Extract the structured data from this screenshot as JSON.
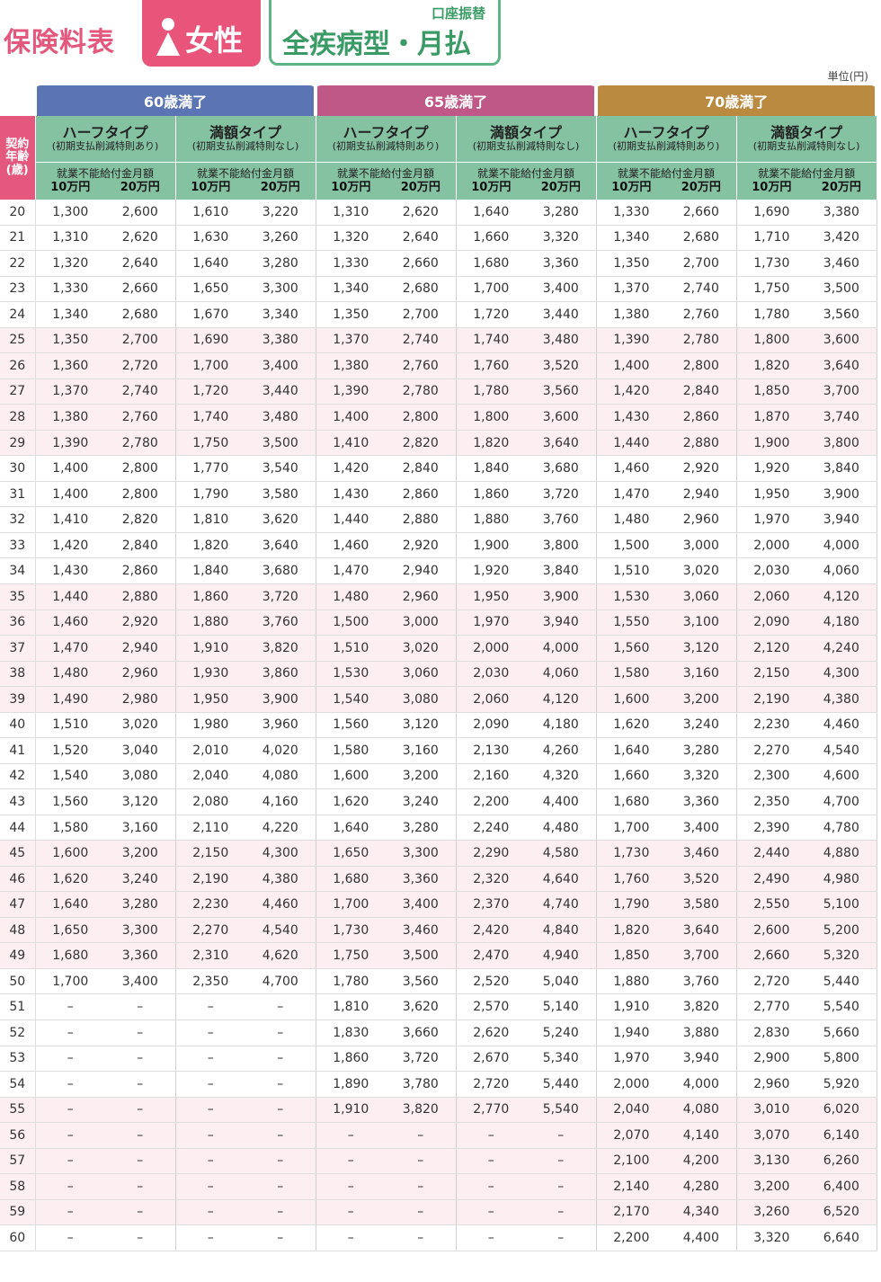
{
  "header": {
    "title": "保険料表",
    "gender_label": "女性",
    "payment_method": "口座振替",
    "plan_label": "全疾病型・月払",
    "unit": "単位(円)"
  },
  "colors": {
    "title_pink": "#e5587d",
    "term_60": "#5a74b4",
    "term_65": "#bf5787",
    "term_70": "#b98a40",
    "header_green": "#84c2a2",
    "row_pink": "#fdeef2"
  },
  "table": {
    "age_header": "契約年齢(歳)",
    "terms": [
      {
        "label": "60歳満了"
      },
      {
        "label": "65歳満了"
      },
      {
        "label": "70歳満了"
      }
    ],
    "types": [
      {
        "name": "ハーフタイプ",
        "note": "(初期支払削減特則あり)"
      },
      {
        "name": "満額タイプ",
        "note": "(初期支払削減特則なし)"
      }
    ],
    "benefit_label": "就業不能給付金月額",
    "amounts": [
      "10万円",
      "20万円"
    ],
    "rows": [
      {
        "age": "20",
        "v": [
          "1,300",
          "2,600",
          "1,610",
          "3,220",
          "1,310",
          "2,620",
          "1,640",
          "3,280",
          "1,330",
          "2,660",
          "1,690",
          "3,380"
        ]
      },
      {
        "age": "21",
        "v": [
          "1,310",
          "2,620",
          "1,630",
          "3,260",
          "1,320",
          "2,640",
          "1,660",
          "3,320",
          "1,340",
          "2,680",
          "1,710",
          "3,420"
        ]
      },
      {
        "age": "22",
        "v": [
          "1,320",
          "2,640",
          "1,640",
          "3,280",
          "1,330",
          "2,660",
          "1,680",
          "3,360",
          "1,350",
          "2,700",
          "1,730",
          "3,460"
        ]
      },
      {
        "age": "23",
        "v": [
          "1,330",
          "2,660",
          "1,650",
          "3,300",
          "1,340",
          "2,680",
          "1,700",
          "3,400",
          "1,370",
          "2,740",
          "1,750",
          "3,500"
        ]
      },
      {
        "age": "24",
        "v": [
          "1,340",
          "2,680",
          "1,670",
          "3,340",
          "1,350",
          "2,700",
          "1,720",
          "3,440",
          "1,380",
          "2,760",
          "1,780",
          "3,560"
        ]
      },
      {
        "age": "25",
        "v": [
          "1,350",
          "2,700",
          "1,690",
          "3,380",
          "1,370",
          "2,740",
          "1,740",
          "3,480",
          "1,390",
          "2,780",
          "1,800",
          "3,600"
        ]
      },
      {
        "age": "26",
        "v": [
          "1,360",
          "2,720",
          "1,700",
          "3,400",
          "1,380",
          "2,760",
          "1,760",
          "3,520",
          "1,400",
          "2,800",
          "1,820",
          "3,640"
        ]
      },
      {
        "age": "27",
        "v": [
          "1,370",
          "2,740",
          "1,720",
          "3,440",
          "1,390",
          "2,780",
          "1,780",
          "3,560",
          "1,420",
          "2,840",
          "1,850",
          "3,700"
        ]
      },
      {
        "age": "28",
        "v": [
          "1,380",
          "2,760",
          "1,740",
          "3,480",
          "1,400",
          "2,800",
          "1,800",
          "3,600",
          "1,430",
          "2,860",
          "1,870",
          "3,740"
        ]
      },
      {
        "age": "29",
        "v": [
          "1,390",
          "2,780",
          "1,750",
          "3,500",
          "1,410",
          "2,820",
          "1,820",
          "3,640",
          "1,440",
          "2,880",
          "1,900",
          "3,800"
        ]
      },
      {
        "age": "30",
        "v": [
          "1,400",
          "2,800",
          "1,770",
          "3,540",
          "1,420",
          "2,840",
          "1,840",
          "3,680",
          "1,460",
          "2,920",
          "1,920",
          "3,840"
        ]
      },
      {
        "age": "31",
        "v": [
          "1,400",
          "2,800",
          "1,790",
          "3,580",
          "1,430",
          "2,860",
          "1,860",
          "3,720",
          "1,470",
          "2,940",
          "1,950",
          "3,900"
        ]
      },
      {
        "age": "32",
        "v": [
          "1,410",
          "2,820",
          "1,810",
          "3,620",
          "1,440",
          "2,880",
          "1,880",
          "3,760",
          "1,480",
          "2,960",
          "1,970",
          "3,940"
        ]
      },
      {
        "age": "33",
        "v": [
          "1,420",
          "2,840",
          "1,820",
          "3,640",
          "1,460",
          "2,920",
          "1,900",
          "3,800",
          "1,500",
          "3,000",
          "2,000",
          "4,000"
        ]
      },
      {
        "age": "34",
        "v": [
          "1,430",
          "2,860",
          "1,840",
          "3,680",
          "1,470",
          "2,940",
          "1,920",
          "3,840",
          "1,510",
          "3,020",
          "2,030",
          "4,060"
        ]
      },
      {
        "age": "35",
        "v": [
          "1,440",
          "2,880",
          "1,860",
          "3,720",
          "1,480",
          "2,960",
          "1,950",
          "3,900",
          "1,530",
          "3,060",
          "2,060",
          "4,120"
        ]
      },
      {
        "age": "36",
        "v": [
          "1,460",
          "2,920",
          "1,880",
          "3,760",
          "1,500",
          "3,000",
          "1,970",
          "3,940",
          "1,550",
          "3,100",
          "2,090",
          "4,180"
        ]
      },
      {
        "age": "37",
        "v": [
          "1,470",
          "2,940",
          "1,910",
          "3,820",
          "1,510",
          "3,020",
          "2,000",
          "4,000",
          "1,560",
          "3,120",
          "2,120",
          "4,240"
        ]
      },
      {
        "age": "38",
        "v": [
          "1,480",
          "2,960",
          "1,930",
          "3,860",
          "1,530",
          "3,060",
          "2,030",
          "4,060",
          "1,580",
          "3,160",
          "2,150",
          "4,300"
        ]
      },
      {
        "age": "39",
        "v": [
          "1,490",
          "2,980",
          "1,950",
          "3,900",
          "1,540",
          "3,080",
          "2,060",
          "4,120",
          "1,600",
          "3,200",
          "2,190",
          "4,380"
        ]
      },
      {
        "age": "40",
        "v": [
          "1,510",
          "3,020",
          "1,980",
          "3,960",
          "1,560",
          "3,120",
          "2,090",
          "4,180",
          "1,620",
          "3,240",
          "2,230",
          "4,460"
        ]
      },
      {
        "age": "41",
        "v": [
          "1,520",
          "3,040",
          "2,010",
          "4,020",
          "1,580",
          "3,160",
          "2,130",
          "4,260",
          "1,640",
          "3,280",
          "2,270",
          "4,540"
        ]
      },
      {
        "age": "42",
        "v": [
          "1,540",
          "3,080",
          "2,040",
          "4,080",
          "1,600",
          "3,200",
          "2,160",
          "4,320",
          "1,660",
          "3,320",
          "2,300",
          "4,600"
        ]
      },
      {
        "age": "43",
        "v": [
          "1,560",
          "3,120",
          "2,080",
          "4,160",
          "1,620",
          "3,240",
          "2,200",
          "4,400",
          "1,680",
          "3,360",
          "2,350",
          "4,700"
        ]
      },
      {
        "age": "44",
        "v": [
          "1,580",
          "3,160",
          "2,110",
          "4,220",
          "1,640",
          "3,280",
          "2,240",
          "4,480",
          "1,700",
          "3,400",
          "2,390",
          "4,780"
        ]
      },
      {
        "age": "45",
        "v": [
          "1,600",
          "3,200",
          "2,150",
          "4,300",
          "1,650",
          "3,300",
          "2,290",
          "4,580",
          "1,730",
          "3,460",
          "2,440",
          "4,880"
        ]
      },
      {
        "age": "46",
        "v": [
          "1,620",
          "3,240",
          "2,190",
          "4,380",
          "1,680",
          "3,360",
          "2,320",
          "4,640",
          "1,760",
          "3,520",
          "2,490",
          "4,980"
        ]
      },
      {
        "age": "47",
        "v": [
          "1,640",
          "3,280",
          "2,230",
          "4,460",
          "1,700",
          "3,400",
          "2,370",
          "4,740",
          "1,790",
          "3,580",
          "2,550",
          "5,100"
        ]
      },
      {
        "age": "48",
        "v": [
          "1,650",
          "3,300",
          "2,270",
          "4,540",
          "1,730",
          "3,460",
          "2,420",
          "4,840",
          "1,820",
          "3,640",
          "2,600",
          "5,200"
        ]
      },
      {
        "age": "49",
        "v": [
          "1,680",
          "3,360",
          "2,310",
          "4,620",
          "1,750",
          "3,500",
          "2,470",
          "4,940",
          "1,850",
          "3,700",
          "2,660",
          "5,320"
        ]
      },
      {
        "age": "50",
        "v": [
          "1,700",
          "3,400",
          "2,350",
          "4,700",
          "1,780",
          "3,560",
          "2,520",
          "5,040",
          "1,880",
          "3,760",
          "2,720",
          "5,440"
        ]
      },
      {
        "age": "51",
        "v": [
          "–",
          "–",
          "–",
          "–",
          "1,810",
          "3,620",
          "2,570",
          "5,140",
          "1,910",
          "3,820",
          "2,770",
          "5,540"
        ]
      },
      {
        "age": "52",
        "v": [
          "–",
          "–",
          "–",
          "–",
          "1,830",
          "3,660",
          "2,620",
          "5,240",
          "1,940",
          "3,880",
          "2,830",
          "5,660"
        ]
      },
      {
        "age": "53",
        "v": [
          "–",
          "–",
          "–",
          "–",
          "1,860",
          "3,720",
          "2,670",
          "5,340",
          "1,970",
          "3,940",
          "2,900",
          "5,800"
        ]
      },
      {
        "age": "54",
        "v": [
          "–",
          "–",
          "–",
          "–",
          "1,890",
          "3,780",
          "2,720",
          "5,440",
          "2,000",
          "4,000",
          "2,960",
          "5,920"
        ]
      },
      {
        "age": "55",
        "v": [
          "–",
          "–",
          "–",
          "–",
          "1,910",
          "3,820",
          "2,770",
          "5,540",
          "2,040",
          "4,080",
          "3,010",
          "6,020"
        ]
      },
      {
        "age": "56",
        "v": [
          "–",
          "–",
          "–",
          "–",
          "–",
          "–",
          "–",
          "–",
          "2,070",
          "4,140",
          "3,070",
          "6,140"
        ]
      },
      {
        "age": "57",
        "v": [
          "–",
          "–",
          "–",
          "–",
          "–",
          "–",
          "–",
          "–",
          "2,100",
          "4,200",
          "3,130",
          "6,260"
        ]
      },
      {
        "age": "58",
        "v": [
          "–",
          "–",
          "–",
          "–",
          "–",
          "–",
          "–",
          "–",
          "2,140",
          "4,280",
          "3,200",
          "6,400"
        ]
      },
      {
        "age": "59",
        "v": [
          "–",
          "–",
          "–",
          "–",
          "–",
          "–",
          "–",
          "–",
          "2,170",
          "4,340",
          "3,260",
          "6,520"
        ]
      },
      {
        "age": "60",
        "v": [
          "–",
          "–",
          "–",
          "–",
          "–",
          "–",
          "–",
          "–",
          "2,200",
          "4,400",
          "3,320",
          "6,640"
        ]
      }
    ]
  }
}
